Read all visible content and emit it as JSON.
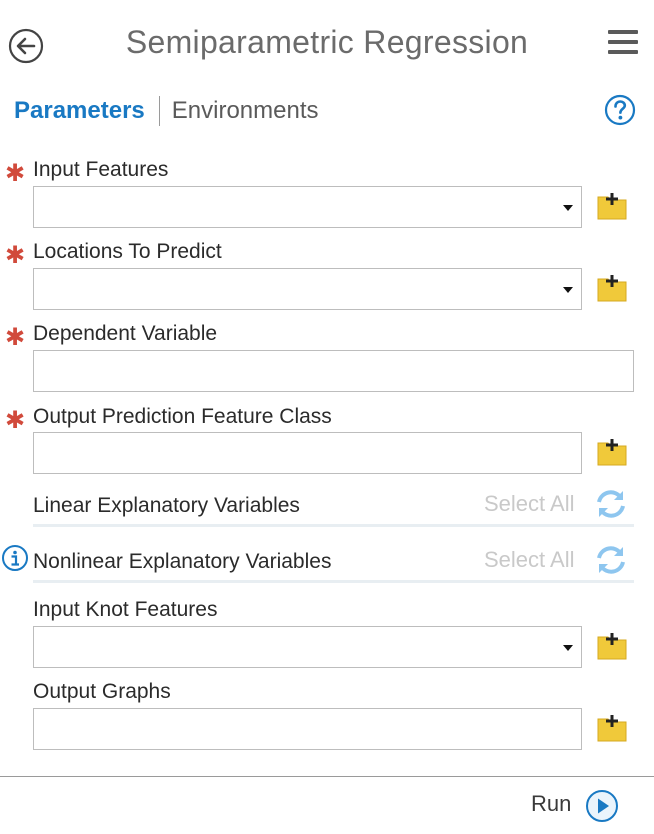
{
  "header": {
    "title": "Semiparametric Regression",
    "back_icon": "back-arrow-circle-icon",
    "menu_icon": "hamburger-menu-icon"
  },
  "tabs": {
    "active": "Parameters",
    "inactive": "Environments",
    "help_icon": "help-question-icon"
  },
  "params": {
    "input_features": {
      "label": "Input Features",
      "required": "✱",
      "value": ""
    },
    "locations": {
      "label": "Locations To Predict",
      "required": "✱",
      "value": ""
    },
    "dependent": {
      "label": "Dependent Variable",
      "required": "✱",
      "value": ""
    },
    "output_class": {
      "label": "Output Prediction Feature Class",
      "required": "✱",
      "value": ""
    },
    "linear": {
      "label": "Linear Explanatory Variables",
      "select_all": "Select All"
    },
    "nonlinear": {
      "label": "Nonlinear Explanatory Variables",
      "select_all": "Select All"
    },
    "knot": {
      "label": "Input Knot Features",
      "value": ""
    },
    "graphs": {
      "label": "Output Graphs",
      "value": ""
    }
  },
  "footer": {
    "run_label": "Run",
    "run_icon": "run-play-icon"
  },
  "colors": {
    "accent": "#1979c3",
    "required": "#d14a3b",
    "folder": "#f0c93a",
    "disabled": "#c9c9c9",
    "refresh": "#8ec6ef"
  }
}
